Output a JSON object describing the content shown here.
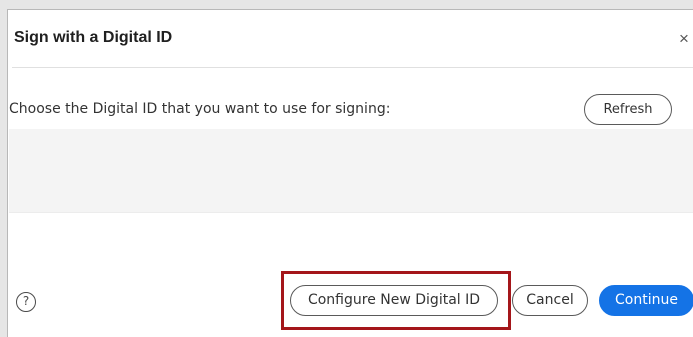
{
  "dialog": {
    "title": "Sign with a Digital ID",
    "close_icon": "close-icon",
    "close_glyph": "×",
    "prompt": "Choose the Digital ID that you want to use for signing:",
    "refresh_label": "Refresh",
    "help_icon": "help-icon",
    "help_glyph": "?",
    "buttons": {
      "configure_label": "Configure New Digital ID",
      "cancel_label": "Cancel",
      "continue_label": "Continue"
    }
  },
  "colors": {
    "primary_button": "#1473e6",
    "highlight_border": "#a4161a",
    "list_background": "#f4f4f4"
  }
}
